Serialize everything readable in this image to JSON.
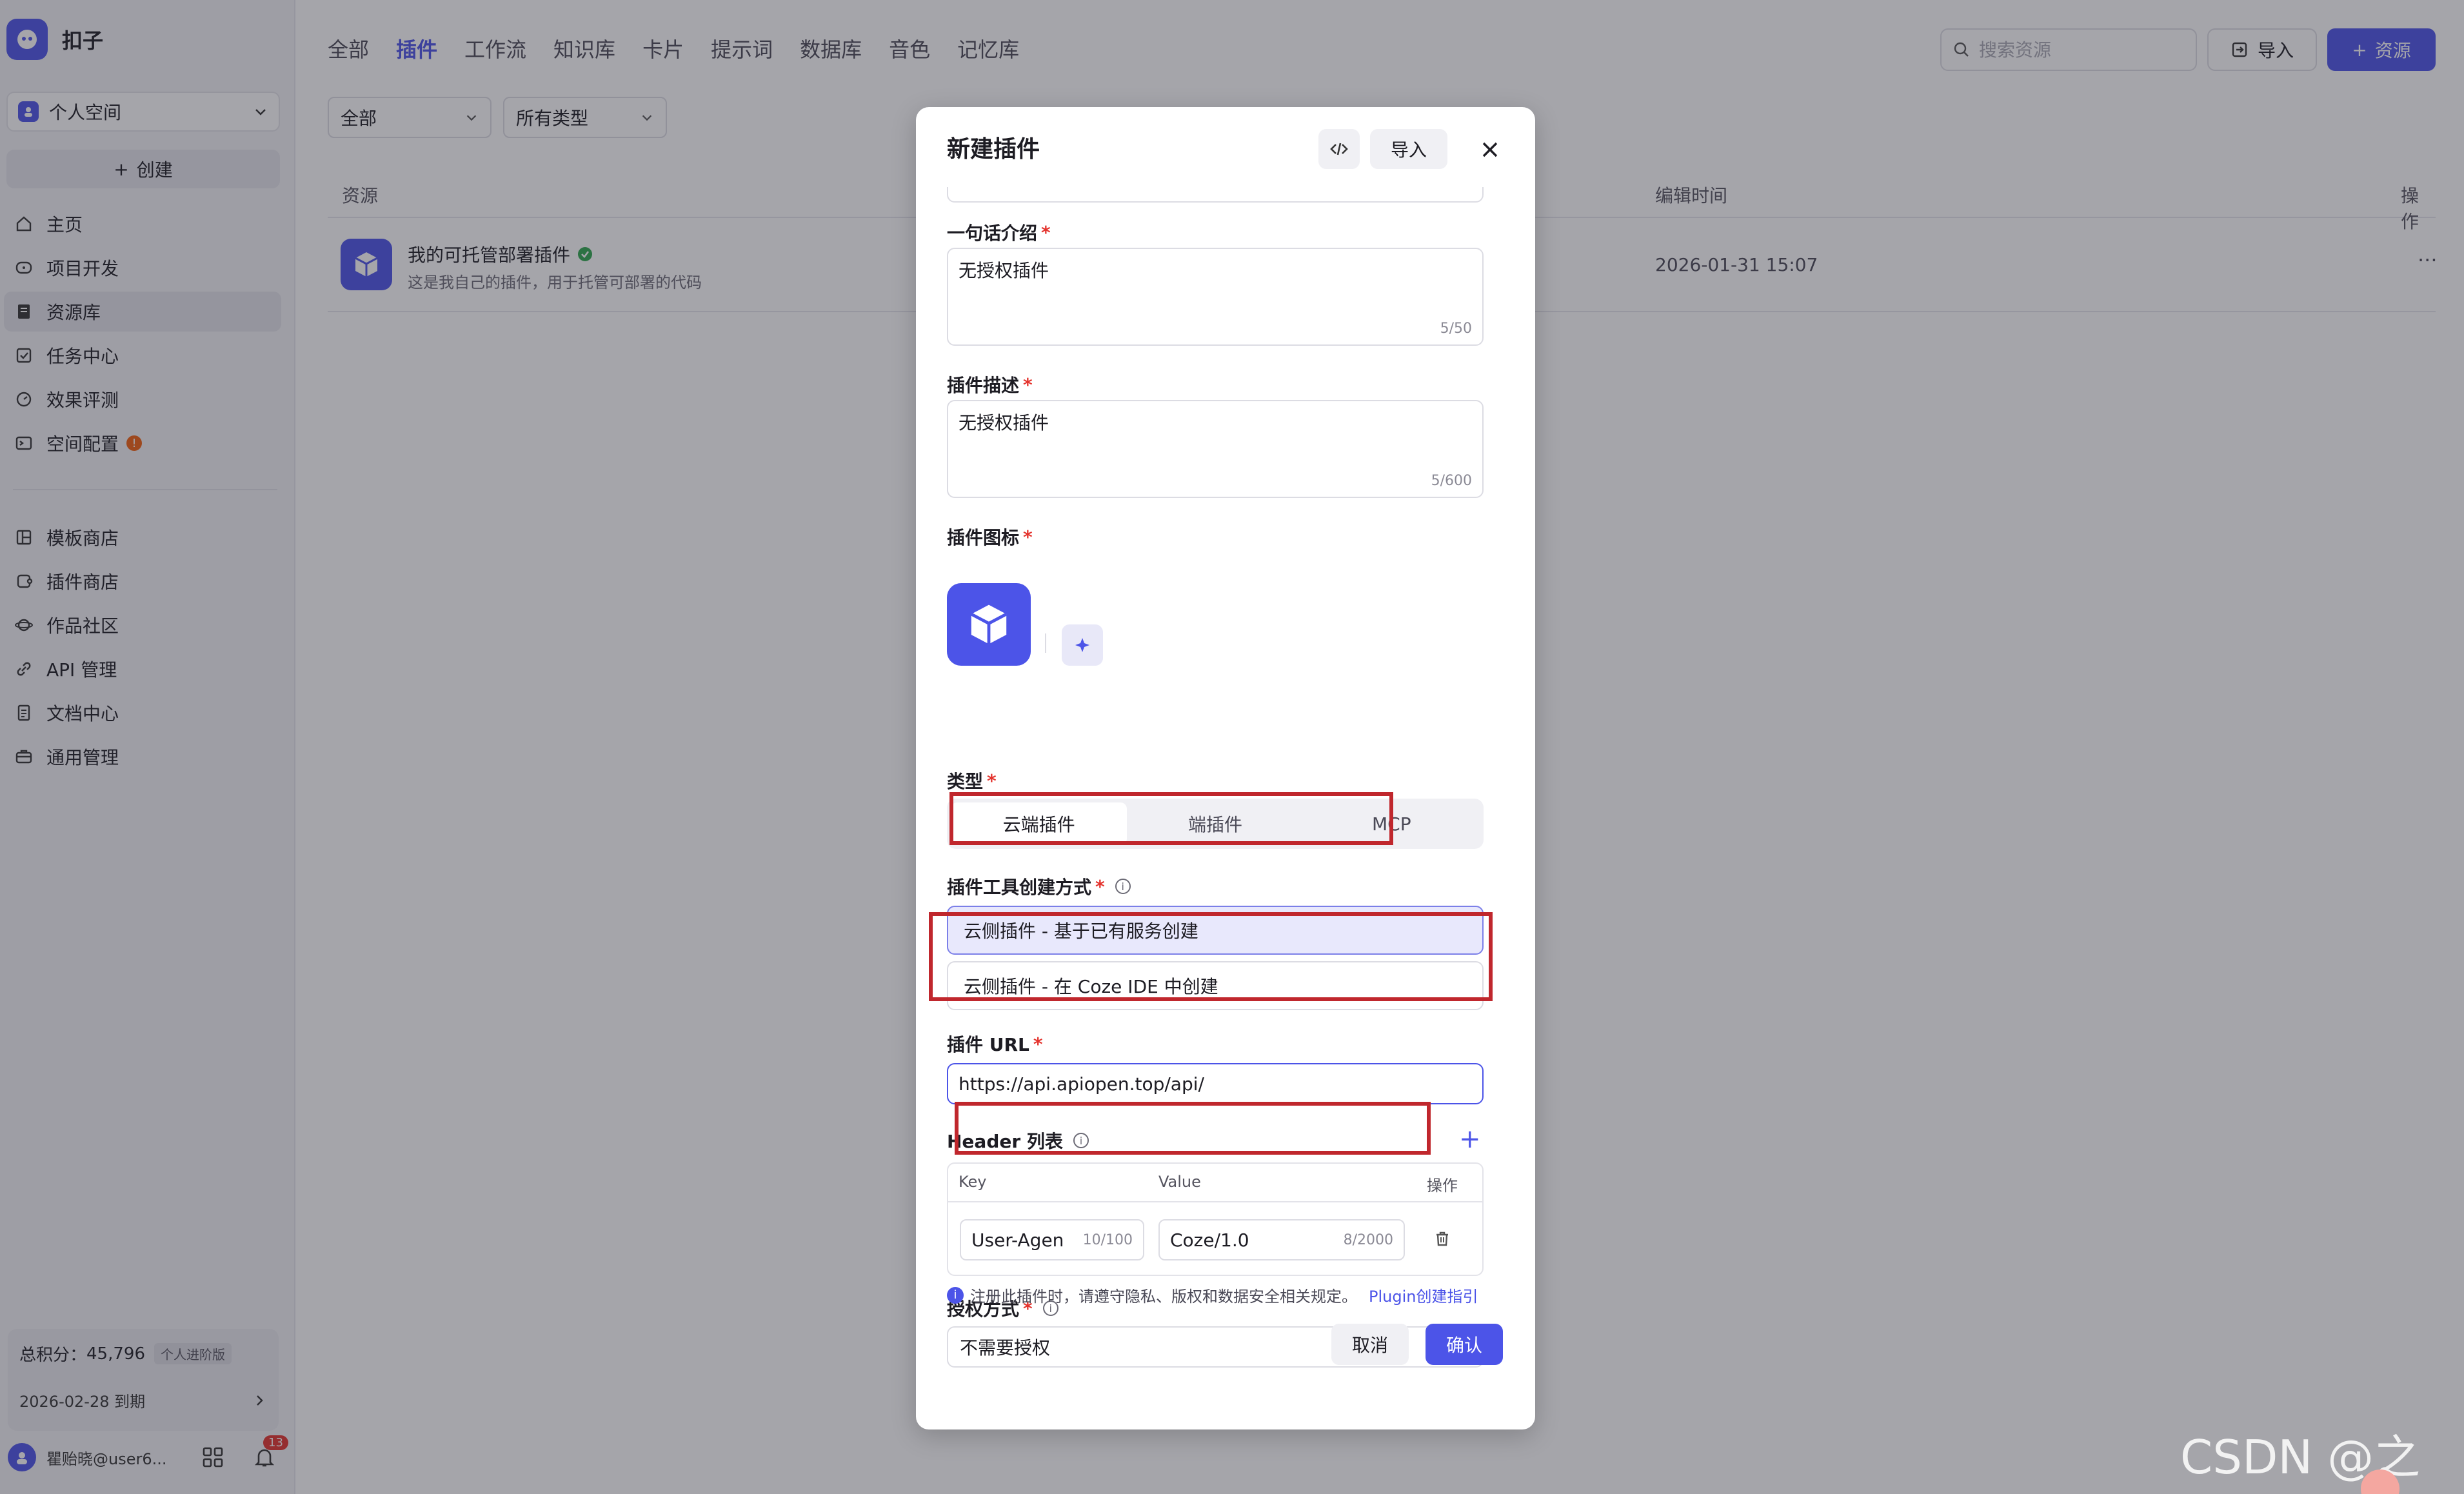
{
  "app": {
    "name": "扣子"
  },
  "sidebar": {
    "space": "个人空间",
    "create_label": "创建",
    "nav_primary": [
      {
        "label": "主页",
        "icon": "home-icon"
      },
      {
        "label": "项目开发",
        "icon": "project-icon"
      },
      {
        "label": "资源库",
        "icon": "library-icon",
        "active": true
      },
      {
        "label": "任务中心",
        "icon": "task-icon"
      },
      {
        "label": "效果评测",
        "icon": "evaluation-icon"
      },
      {
        "label": "空间配置",
        "icon": "config-icon",
        "badge": "!"
      }
    ],
    "nav_secondary": [
      {
        "label": "模板商店",
        "icon": "template-icon"
      },
      {
        "label": "插件商店",
        "icon": "plugin-store-icon"
      },
      {
        "label": "作品社区",
        "icon": "community-icon"
      },
      {
        "label": "API 管理",
        "icon": "api-icon"
      },
      {
        "label": "文档中心",
        "icon": "docs-icon"
      },
      {
        "label": "通用管理",
        "icon": "manage-icon"
      }
    ],
    "credits_label": "总积分：",
    "credits_value": "45,796",
    "plan_tag": "个人进阶版",
    "expiry": "2026-02-28 到期",
    "user_name": "瞿贻晓@user6...",
    "notification_count": "13"
  },
  "main": {
    "tabs": [
      "全部",
      "插件",
      "工作流",
      "知识库",
      "卡片",
      "提示词",
      "数据库",
      "音色",
      "记忆库"
    ],
    "active_tab": "插件",
    "search_placeholder": "搜索资源",
    "import_label": "导入",
    "resource_label": "资源",
    "filter_all": "全部",
    "filter_type": "所有类型",
    "columns": {
      "resource": "资源",
      "edit_time": "编辑时间",
      "actions": "操作"
    },
    "rows": [
      {
        "title": "我的可托管部署插件",
        "desc": "这是我自己的插件，用于托管可部署的代码",
        "time": "2026-01-31 15:07",
        "more": "···"
      }
    ]
  },
  "modal": {
    "title": "新建插件",
    "import_label": "导入",
    "intro": {
      "label": "一句话介绍",
      "value": "无授权插件",
      "count": "5/50"
    },
    "description": {
      "label": "插件描述",
      "value": "无授权插件",
      "count": "5/600"
    },
    "icon_label": "插件图标",
    "type": {
      "label": "类型",
      "options": [
        "云端插件",
        "端插件",
        "MCP"
      ],
      "selected": "云端插件"
    },
    "creation": {
      "label": "插件工具创建方式",
      "options": [
        "云侧插件 - 基于已有服务创建",
        "云侧插件 - 在 Coze IDE 中创建"
      ],
      "selected_index": 0
    },
    "url": {
      "label": "插件 URL",
      "value": "https://api.apiopen.top/api/"
    },
    "headers": {
      "label": "Header 列表",
      "col_key": "Key",
      "col_value": "Value",
      "col_actions": "操作",
      "rows": [
        {
          "key": "User-Agen",
          "key_count": "10/100",
          "value": "Coze/1.0",
          "value_count": "8/2000"
        }
      ]
    },
    "auth": {
      "label": "授权方式",
      "value": "不需要授权"
    },
    "notice": "注册此插件时，请遵守隐私、版权和数据安全相关规定。",
    "notice_link": "Plugin创建指引",
    "cancel_label": "取消",
    "confirm_label": "确认"
  },
  "colors": {
    "accent": "#4c54e8",
    "annotation": "#c0272d"
  },
  "watermark": "CSDN @之歆"
}
